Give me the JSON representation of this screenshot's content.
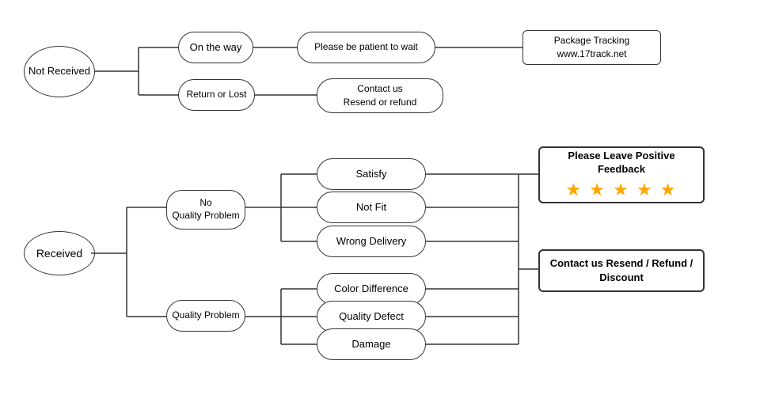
{
  "nodes": {
    "not_received": {
      "label": "Not\nReceived"
    },
    "on_the_way": {
      "label": "On the way"
    },
    "return_or_lost": {
      "label": "Return or Lost"
    },
    "be_patient": {
      "label": "Please be patient to wait"
    },
    "contact_resend_refund": {
      "label": "Contact us\nResend or refund"
    },
    "package_tracking": {
      "label": "Package Tracking\nwww.17track.net"
    },
    "received": {
      "label": "Received"
    },
    "no_quality_problem": {
      "label": "No\nQuality Problem"
    },
    "quality_problem": {
      "label": "Quality Problem"
    },
    "satisfy": {
      "label": "Satisfy"
    },
    "not_fit": {
      "label": "Not Fit"
    },
    "wrong_delivery": {
      "label": "Wrong Delivery"
    },
    "color_difference": {
      "label": "Color Difference"
    },
    "quality_defect": {
      "label": "Quality Defect"
    },
    "damage": {
      "label": "Damage"
    },
    "please_leave_feedback": {
      "label": "Please Leave Positive Feedback"
    },
    "stars": {
      "value": "★ ★ ★ ★ ★"
    },
    "contact_resend_refund_discount": {
      "label": "Contact us\nResend / Refund / Discount"
    }
  }
}
